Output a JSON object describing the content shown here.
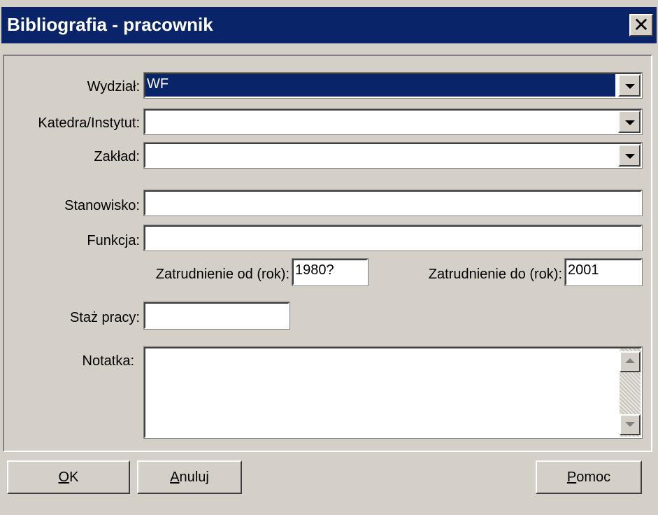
{
  "window": {
    "title": "Bibliografia - pracownik",
    "close_label": "✕"
  },
  "form": {
    "wydzial": {
      "label": "Wydział:",
      "value": "WF"
    },
    "katedra": {
      "label": "Katedra/Instytut:",
      "value": ""
    },
    "zaklad": {
      "label": "Zakład:",
      "value": ""
    },
    "stanowisko": {
      "label": "Stanowisko:",
      "value": ""
    },
    "funkcja": {
      "label": "Funkcja:",
      "value": ""
    },
    "zatrudnienie_od": {
      "label": "Zatrudnienie od (rok):",
      "value": "1980?"
    },
    "zatrudnienie_do": {
      "label": "Zatrudnienie do (rok):",
      "value": "2001"
    },
    "staz": {
      "label": "Staż pracy:",
      "value": ""
    },
    "notatka": {
      "label": "Notatka:",
      "value": ""
    }
  },
  "buttons": {
    "ok": {
      "accel": "O",
      "rest": "K"
    },
    "cancel": {
      "accel": "A",
      "rest": "nuluj"
    },
    "help": {
      "accel": "P",
      "rest": "omoc"
    }
  },
  "colors": {
    "titlebar": "#0a246a",
    "face": "#d4d0c8",
    "selection": "#0a246a"
  }
}
